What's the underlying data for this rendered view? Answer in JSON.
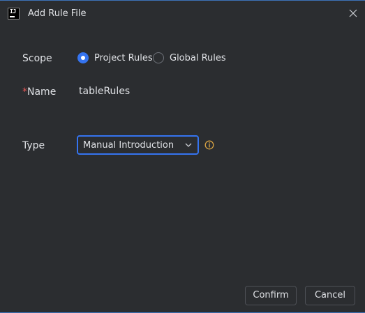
{
  "window": {
    "title": "Add Rule File",
    "app_icon_text": "IJ"
  },
  "form": {
    "scope_label": "Scope",
    "scope_options": [
      {
        "label": "Project Rules",
        "selected": true
      },
      {
        "label": "Global Rules",
        "selected": false
      }
    ],
    "name_required_mark": "*",
    "name_label": "Name",
    "name_value": "tableRules",
    "type_label": "Type",
    "type_selected": "Manual Introduction"
  },
  "buttons": {
    "confirm": "Confirm",
    "cancel": "Cancel"
  },
  "colors": {
    "background": "#2b2d30",
    "accent": "#3574f0",
    "required": "#e55757",
    "info": "#d9a343",
    "text": "#dfe1e5"
  },
  "icons": {
    "app": "intellij-icon",
    "close": "close-icon",
    "dropdown": "chevron-down-icon",
    "info": "info-icon"
  }
}
